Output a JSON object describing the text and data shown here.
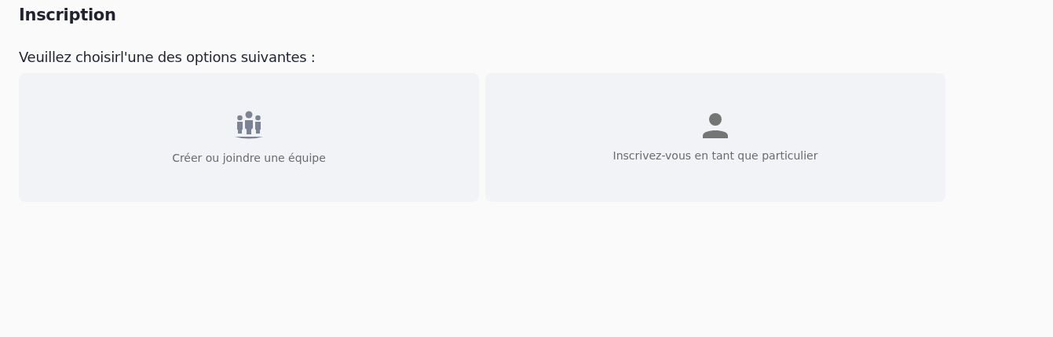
{
  "title": "Inscription",
  "prompt": "Veuillez choisirl'une des options suivantes :",
  "options": [
    {
      "kind": "team",
      "label": "Créer ou joindre une équipe"
    },
    {
      "kind": "individual",
      "label": "Inscrivez-vous en tant que particulier"
    }
  ]
}
